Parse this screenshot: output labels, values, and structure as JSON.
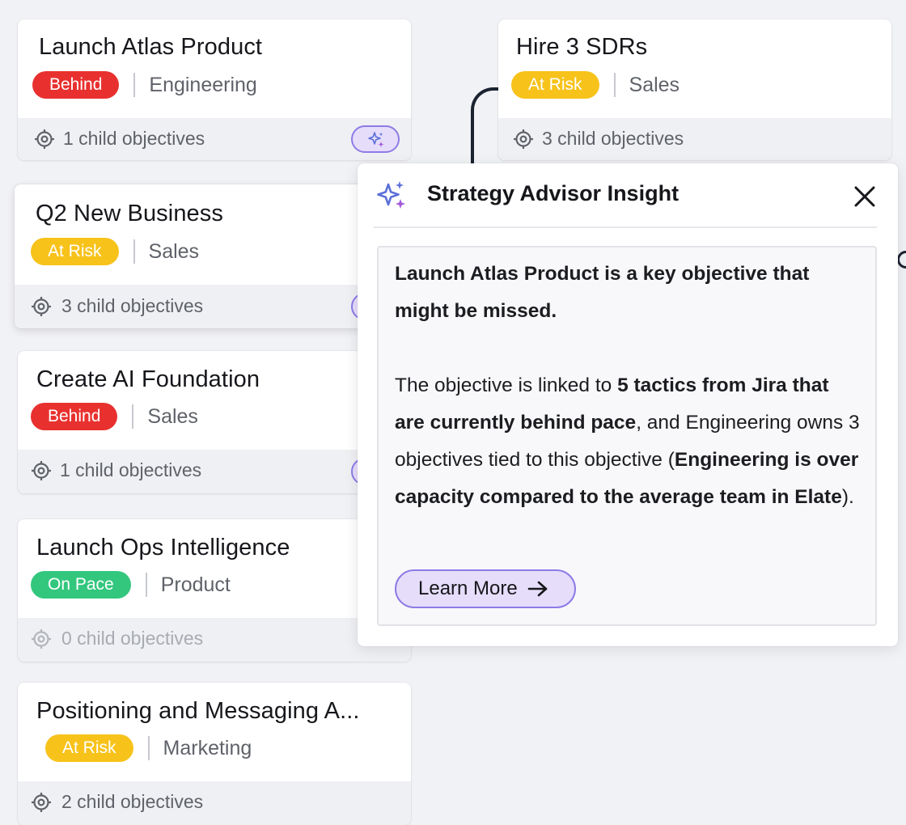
{
  "cards": [
    {
      "title": "Launch Atlas Product",
      "status": "Behind",
      "team": "Engineering",
      "child_objectives": "1 child objectives"
    },
    {
      "title": "Q2 New Business",
      "status": "At Risk",
      "team": "Sales",
      "child_objectives": "3 child objectives"
    },
    {
      "title": "Create AI Foundation",
      "status": "Behind",
      "team": "Sales",
      "child_objectives": "1 child objectives"
    },
    {
      "title": "Launch Ops Intelligence",
      "status": "On Pace",
      "team": "Product",
      "child_objectives": "0 child objectives"
    },
    {
      "title": "Positioning and Messaging A...",
      "status": "At Risk",
      "team": "Marketing",
      "child_objectives": "2 child objectives"
    },
    {
      "title": "Hire 3 SDRs",
      "status": "At Risk",
      "team": "Sales",
      "child_objectives": "3 child objectives"
    }
  ],
  "insight": {
    "title": "Strategy Advisor Insight",
    "headline": "Launch Atlas Product is a key objective that might be missed.",
    "body": {
      "p1": "The objective is linked to ",
      "b1": "5 tactics from Jira that are currently behind pace",
      "p2": ", and Engineering owns 3 objectives tied to this objective (",
      "b2": "Engineering is over capacity compared to the average team in Elate",
      "p3": ")."
    },
    "learn_more": "Learn More"
  },
  "colors": {
    "behind": "#e8312f",
    "at_risk": "#f7c21a",
    "on_pace": "#33c77e",
    "ai_accent": "#8d7be6",
    "ai_fill": "#e6ddfb"
  },
  "icons": {
    "child_objectives": "target-icon",
    "ai": "sparkles-icon",
    "close": "close-icon",
    "learn_more": "arrow-right-icon"
  }
}
